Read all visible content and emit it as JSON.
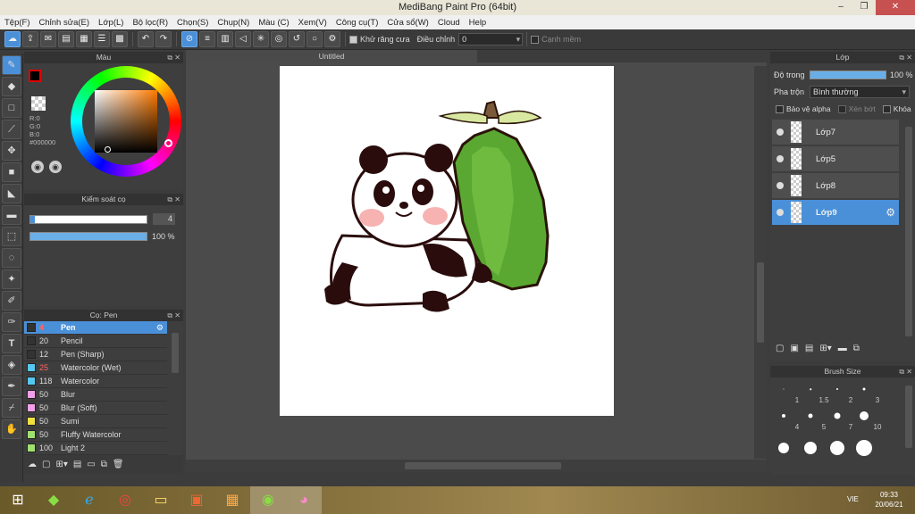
{
  "app": {
    "title": "MediBang Paint Pro (64bit)"
  },
  "menu": [
    "Tệp(F)",
    "Chỉnh sửa(E)",
    "Lớp(L)",
    "Bộ lọc(R)",
    "Chọn(S)",
    "Chụp(N)",
    "Màu (C)",
    "Xem(V)",
    "Công cụ(T)",
    "Cửa sổ(W)",
    "Cloud",
    "Help"
  ],
  "toolbar": {
    "antialias_label": "Khử răng cưa",
    "adjust_label": "Điều chỉnh",
    "adjust_value": "0",
    "edge_label": "Cạnh mềm"
  },
  "color_panel": {
    "title": "Màu",
    "r": "R:0",
    "g": "G:0",
    "b": "B:0",
    "hex": "#000000"
  },
  "brush_control": {
    "title": "Kiểm soát cọ",
    "size": "4",
    "opacity": "100 %",
    "opacity_fill": 1.0
  },
  "brush_panel": {
    "title": "Cọ: Pen",
    "items": [
      {
        "size": "4",
        "name": "Pen",
        "color": "#333333",
        "size_color": "#ff6666",
        "selected": true
      },
      {
        "size": "20",
        "name": "Pencil",
        "color": "#333333",
        "size_color": "#dddddd"
      },
      {
        "size": "12",
        "name": "Pen (Sharp)",
        "color": "#333333",
        "size_color": "#dddddd"
      },
      {
        "size": "25",
        "name": "Watercolor (Wet)",
        "color": "#55c8f0",
        "size_color": "#ff6666"
      },
      {
        "size": "118",
        "name": "Watercolor",
        "color": "#55c8f0",
        "size_color": "#dddddd"
      },
      {
        "size": "50",
        "name": "Blur",
        "color": "#f0a0e8",
        "size_color": "#dddddd"
      },
      {
        "size": "50",
        "name": "Blur (Soft)",
        "color": "#f0a0e8",
        "size_color": "#dddddd"
      },
      {
        "size": "50",
        "name": "Sumi",
        "color": "#f0e040",
        "size_color": "#dddddd"
      },
      {
        "size": "50",
        "name": "Fluffy Watercolor",
        "color": "#a0e070",
        "size_color": "#dddddd"
      },
      {
        "size": "100",
        "name": "Light 2",
        "color": "#a0e070",
        "size_color": "#dddddd"
      }
    ]
  },
  "canvas": {
    "tab": "Untitled"
  },
  "layer_panel": {
    "title": "Lớp",
    "opacity_label": "Độ trong",
    "opacity_value": "100 %",
    "blend_label": "Pha trộn",
    "blend_value": "Bình thường",
    "protect_alpha": "Bảo vệ alpha",
    "clipping": "Xén bớt",
    "lock": "Khóa",
    "layers": [
      {
        "name": "Lớp7",
        "selected": false
      },
      {
        "name": "Lớp5",
        "selected": false
      },
      {
        "name": "Lớp8",
        "selected": false
      },
      {
        "name": "Lớp9",
        "selected": true
      }
    ]
  },
  "brush_size_panel": {
    "title": "Brush Size",
    "sizes": [
      "1",
      "1.5",
      "2",
      "3",
      "4",
      "5",
      "7",
      "10",
      "",
      "",
      "",
      ""
    ]
  },
  "taskbar": {
    "lang": "VIE",
    "time": "09:33",
    "date": "20/06/21"
  }
}
